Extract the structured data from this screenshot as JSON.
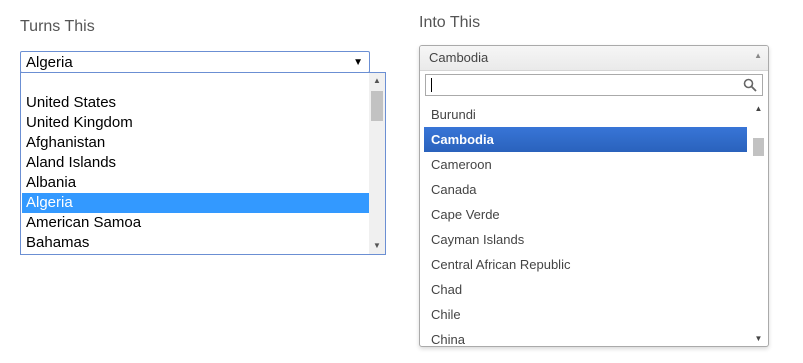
{
  "left": {
    "heading": "Turns This",
    "selected_value": "Algeria",
    "options": [
      "",
      "United States",
      "United Kingdom",
      "Afghanistan",
      "Aland Islands",
      "Albania",
      "Algeria",
      "American Samoa",
      "Bahamas"
    ],
    "selected_index": 6,
    "highlight_color": "#3399ff",
    "icons": {
      "dropdown": "caret-down-icon",
      "scroll_up": "scroll-up-arrow-icon",
      "scroll_down": "scroll-down-arrow-icon"
    }
  },
  "right": {
    "heading": "Into This",
    "selected_value": "Cambodia",
    "search": {
      "value": "",
      "placeholder": ""
    },
    "options": [
      "Burundi",
      "Cambodia",
      "Cameroon",
      "Canada",
      "Cape Verde",
      "Cayman Islands",
      "Central African Republic",
      "Chad",
      "Chile",
      "China"
    ],
    "highlighted_index": 1,
    "highlight_color": "#3875d7",
    "icons": {
      "collapse": "caret-up-icon",
      "search": "search-icon",
      "scroll_up": "scroll-up-arrow-icon",
      "scroll_down": "scroll-down-arrow-icon"
    }
  }
}
